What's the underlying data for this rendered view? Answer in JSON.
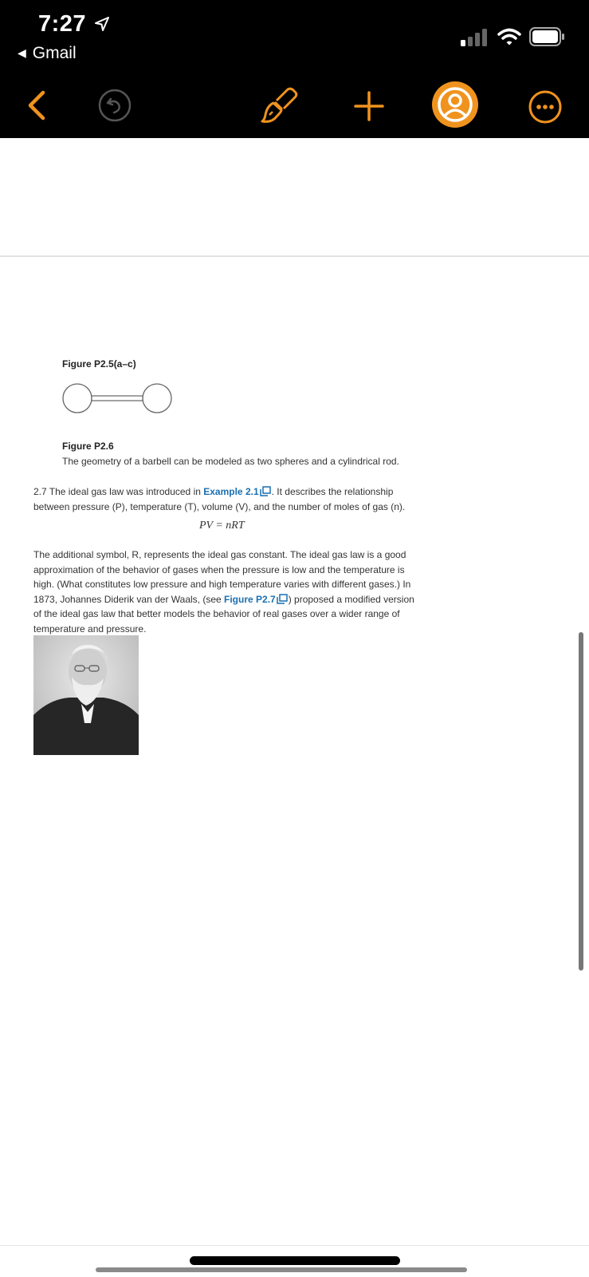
{
  "status_bar": {
    "time": "7:27",
    "back_app": "Gmail"
  },
  "toolbar": {
    "icons": [
      "back-chevron-icon",
      "undo-icon",
      "brush-icon",
      "plus-icon",
      "profile-icon",
      "more-icon"
    ],
    "accent_color": "#f0931e"
  },
  "document": {
    "figure1_caption": "Figure P2.5(a–c)",
    "figure2_title": "Figure P2.6",
    "figure2_caption": "The geometry of a barbell can be modeled as two spheres and a cylindrical rod.",
    "para1": {
      "pre": "2.7 The ideal gas law was introduced in ",
      "link": "Example 2.1",
      "post": ". It describes the relationship between pressure (P), temperature (T), volume (V), and the number of moles of gas (n)."
    },
    "equation": "PV = nRT",
    "para2": {
      "pre": "The additional symbol, R, represents the ideal gas constant. The ideal gas law is a good approximation of the behavior of gases when the pressure is low and the temperature is high. (What constitutes low pressure and high temperature varies with different gases.) In 1873, Johannes Diderik van der Waals, (see ",
      "link": "Figure P2.7",
      "post": ") proposed a modified version of the ideal gas law that better models the behavior of real gases over a wider range of temperature and pressure."
    }
  }
}
